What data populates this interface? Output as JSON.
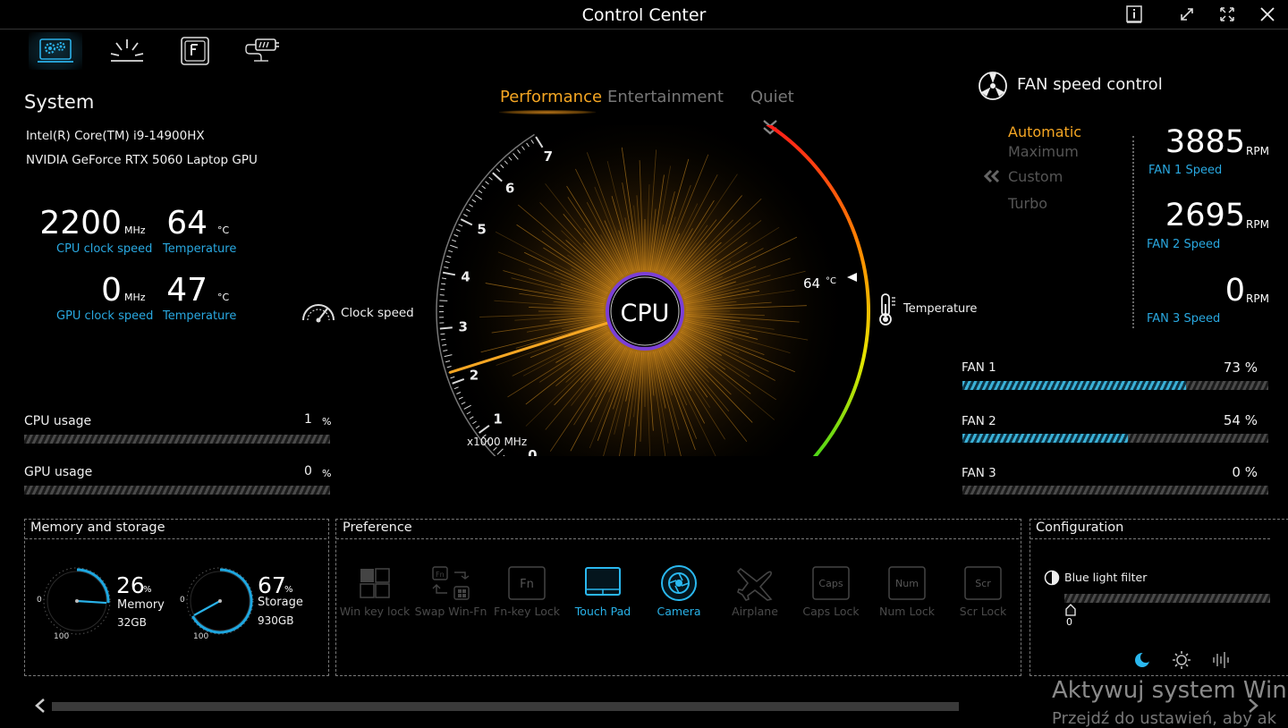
{
  "window": {
    "title": "Control Center"
  },
  "system": {
    "title": "System",
    "cpu_name": "Intel(R) Core(TM) i9-14900HX",
    "gpu_name": "NVIDIA GeForce RTX 5060 Laptop GPU",
    "cpu_clock": "2200",
    "cpu_clock_unit": "MHz",
    "cpu_clock_label": "CPU clock speed",
    "cpu_temp": "64",
    "cpu_temp_unit": "°C",
    "cpu_temp_label": "Temperature",
    "gpu_clock": "0",
    "gpu_clock_unit": "MHz",
    "gpu_clock_label": "GPU clock speed",
    "gpu_temp": "47",
    "gpu_temp_unit": "°C",
    "gpu_temp_label": "Temperature",
    "cpu_usage_label": "CPU usage",
    "cpu_usage_value": "1",
    "gpu_usage_label": "GPU usage",
    "gpu_usage_value": "0",
    "usage_unit": "%"
  },
  "modes": {
    "items": [
      "Performance",
      "Entertainment",
      "Quiet"
    ],
    "active": "Performance"
  },
  "gauge": {
    "center_label": "CPU",
    "clock_label": "Clock speed",
    "temperature_label": "Temperature",
    "scale_unit": "x1000 MHz",
    "ticks": [
      "0",
      "1",
      "2",
      "3",
      "4",
      "5",
      "6",
      "7"
    ],
    "clock_value_khz": 2.2,
    "temp_readout": "64",
    "temp_unit": "°C"
  },
  "fan": {
    "title": "FAN speed control",
    "modes": [
      "Automatic",
      "Maximum",
      "Custom",
      "Turbo"
    ],
    "active_mode": "Automatic",
    "fans": [
      {
        "rpm": "3885",
        "unit": "RPM",
        "label": "FAN 1 Speed"
      },
      {
        "rpm": "2695",
        "unit": "RPM",
        "label": "FAN 2 Speed"
      },
      {
        "rpm": "0",
        "unit": "RPM",
        "label": "FAN 3 Speed"
      }
    ],
    "bars": [
      {
        "label": "FAN 1",
        "pct": "73 %",
        "value": 73
      },
      {
        "label": "FAN 2",
        "pct": "54 %",
        "value": 54
      },
      {
        "label": "FAN 3",
        "pct": "0 %",
        "value": 0
      }
    ],
    "colors": {
      "accent": "#f5a623",
      "blue": "#29a8e0"
    }
  },
  "memory": {
    "title": "Memory and storage",
    "mem_pct": "26",
    "mem_pct_unit": "%",
    "mem_label": "Memory",
    "mem_size": "32GB",
    "storage_pct": "67",
    "storage_pct_unit": "%",
    "storage_label": "Storage",
    "storage_size": "930GB",
    "dial_min": "0",
    "dial_max": "100"
  },
  "preference": {
    "title": "Preference",
    "items": [
      {
        "label": "Win key lock",
        "on": false,
        "icon": "windows-icon"
      },
      {
        "label": "Swap Win-Fn",
        "on": false,
        "icon": "swap-icon"
      },
      {
        "label": "Fn-key Lock",
        "on": false,
        "icon": "fn-key-icon"
      },
      {
        "label": "Touch Pad",
        "on": true,
        "icon": "touchpad-icon"
      },
      {
        "label": "Camera",
        "on": true,
        "icon": "camera-icon"
      },
      {
        "label": "Airplane",
        "on": false,
        "icon": "airplane-icon"
      },
      {
        "label": "Caps Lock",
        "on": false,
        "icon": "caps-lock-icon"
      },
      {
        "label": "Num Lock",
        "on": false,
        "icon": "num-lock-icon"
      },
      {
        "label": "Scr Lock",
        "on": false,
        "icon": "scroll-lock-icon"
      }
    ],
    "key_labels": {
      "fn": "Fn",
      "caps": "Caps",
      "num": "Num",
      "scr": "Scr"
    }
  },
  "configuration": {
    "title": "Configuration",
    "blue_light_label": "Blue light filter",
    "blue_light_value": "0"
  },
  "watermark": {
    "line1": "Aktywuj system Win",
    "line2": "Przejdź do ustawień, aby ak"
  }
}
